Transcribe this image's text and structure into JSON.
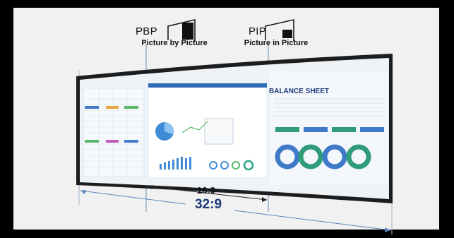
{
  "labels": {
    "pbp_abbr": "PBP",
    "pbp_full": "Picture by Picture",
    "pip_abbr": "PIP",
    "pip_full": "Picture in Picture",
    "ratio_small": "16:9",
    "ratio_large": "32:9"
  },
  "monitor": {
    "right_panel_title": "BALANCE SHEET"
  },
  "colors": {
    "background": "#000000",
    "panel": "#f1f1f1",
    "accent_blue": "#1f3a78",
    "dimension_line": "#7a9cc6",
    "bezel": "#222222"
  }
}
